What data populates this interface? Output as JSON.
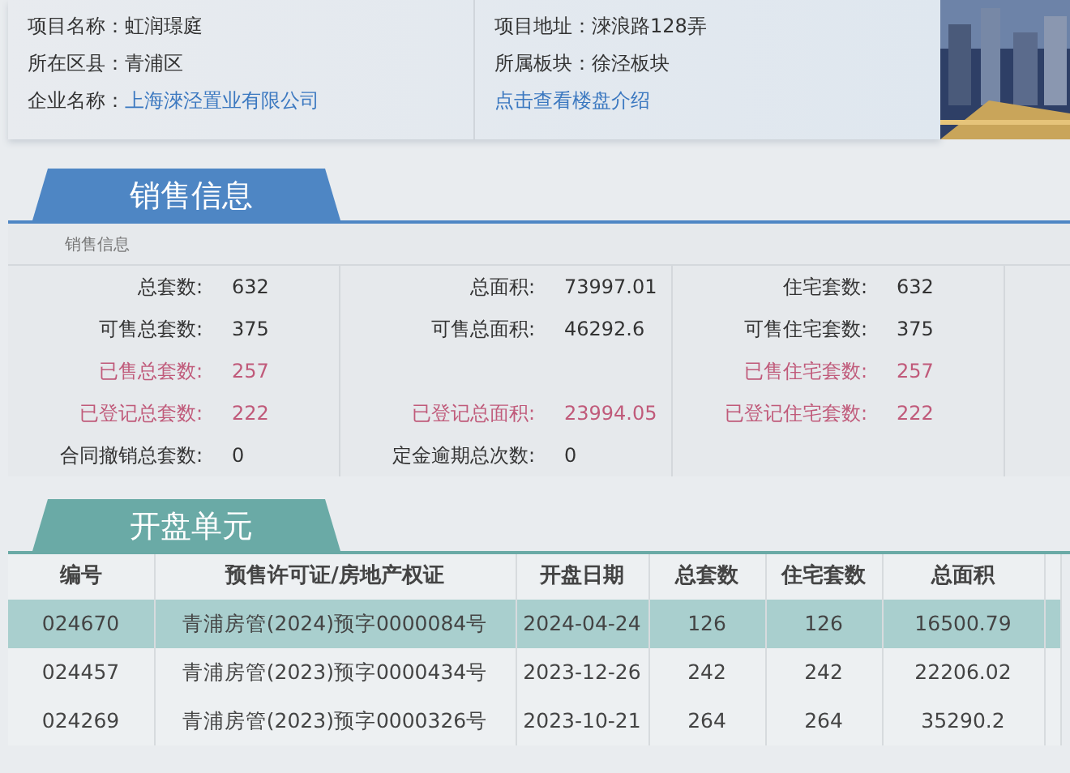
{
  "project_info": {
    "left": [
      {
        "label": "项目名称：",
        "value": "虹润璟庭",
        "kind": "text"
      },
      {
        "label": "所在区县：",
        "value": "青浦区",
        "kind": "text"
      },
      {
        "label": "企业名称：",
        "value": "上海淶泾置业有限公司",
        "kind": "link"
      }
    ],
    "right": [
      {
        "label": "项目地址：",
        "value": "淶浪路128弄",
        "kind": "text"
      },
      {
        "label": "所属板块：",
        "value": "徐泾板块",
        "kind": "text"
      },
      {
        "value": "点击查看楼盘介绍",
        "kind": "link"
      }
    ]
  },
  "sales": {
    "tab": "销售信息",
    "caption": "销售信息",
    "rows": [
      [
        {
          "label": "总套数:",
          "value": "632"
        },
        {
          "label": "总面积:",
          "value": "73997.01"
        },
        {
          "label": "住宅套数:",
          "value": "632"
        }
      ],
      [
        {
          "label": "可售总套数:",
          "value": "375"
        },
        {
          "label": "可售总面积:",
          "value": "46292.6"
        },
        {
          "label": "可售住宅套数:",
          "value": "375"
        }
      ],
      [
        {
          "label": "已售总套数:",
          "value": "257",
          "kind": "muted"
        },
        null,
        {
          "label": "已售住宅套数:",
          "value": "257",
          "kind": "muted"
        }
      ],
      [
        {
          "label": "已登记总套数:",
          "value": "222",
          "kind": "muted"
        },
        {
          "label": "已登记总面积:",
          "value": "23994.05",
          "kind": "muted"
        },
        {
          "label": "已登记住宅套数:",
          "value": "222",
          "kind": "muted"
        }
      ],
      [
        {
          "label": "合同撤销总套数:",
          "value": "0"
        },
        {
          "label": "定金逾期总次数:",
          "value": "0"
        },
        null
      ]
    ]
  },
  "units": {
    "tab": "开盘单元",
    "columns": [
      "编号",
      "预售许可证/房地产权证",
      "开盘日期",
      "总套数",
      "住宅套数",
      "总面积"
    ],
    "rows": [
      {
        "selected": true,
        "cells": [
          "024670",
          "青浦房管(2024)预字0000084号",
          "2024-04-24",
          "126",
          "126",
          "16500.79"
        ]
      },
      {
        "selected": false,
        "cells": [
          "024457",
          "青浦房管(2023)预字0000434号",
          "2023-12-26",
          "242",
          "242",
          "22206.02"
        ]
      },
      {
        "selected": false,
        "cells": [
          "024269",
          "青浦房管(2023)预字0000326号",
          "2023-10-21",
          "264",
          "264",
          "35290.2"
        ]
      }
    ]
  }
}
